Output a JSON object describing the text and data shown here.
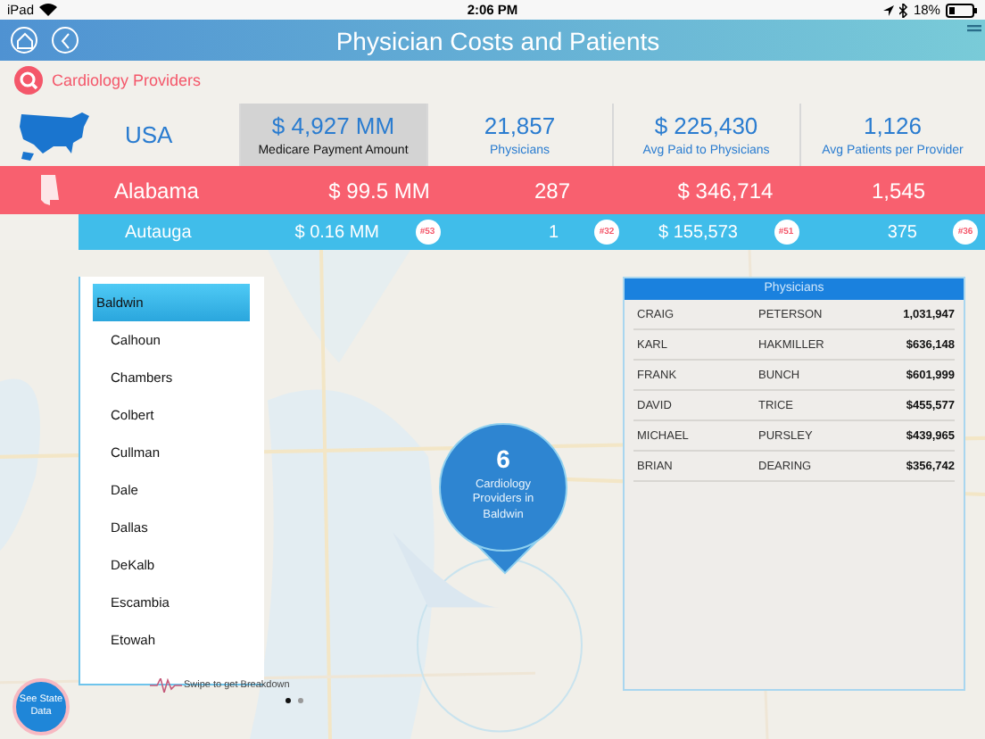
{
  "status_bar": {
    "device": "iPad",
    "time": "2:06 PM",
    "battery": "18%"
  },
  "header": {
    "title": "Physician Costs and Patients"
  },
  "category": {
    "label": "Cardiology Providers"
  },
  "summary": {
    "region": "USA",
    "metrics": [
      {
        "value": "$ 4,927 MM",
        "label": "Medicare Payment Amount",
        "selected": true
      },
      {
        "value": "21,857",
        "label": "Physicians",
        "selected": false
      },
      {
        "value": "$ 225,430",
        "label": "Avg Paid to Physicians",
        "selected": false
      },
      {
        "value": "1,126",
        "label": "Avg Patients per Provider",
        "selected": false
      }
    ]
  },
  "state_row": {
    "name": "Alabama",
    "values": [
      "$ 99.5 MM",
      "287",
      "$ 346,714",
      "1,545"
    ]
  },
  "county_row": {
    "name": "Autauga",
    "cells": [
      {
        "value": "$ 0.16 MM",
        "rank": "#53"
      },
      {
        "value": "1",
        "rank": "#32"
      },
      {
        "value": "$ 155,573",
        "rank": "#51"
      },
      {
        "value": "375",
        "rank": "#36"
      }
    ]
  },
  "county_list": {
    "items": [
      {
        "name": "Baldwin",
        "selected": true
      },
      {
        "name": "Calhoun",
        "selected": false
      },
      {
        "name": "Chambers",
        "selected": false
      },
      {
        "name": "Colbert",
        "selected": false
      },
      {
        "name": "Cullman",
        "selected": false
      },
      {
        "name": "Dale",
        "selected": false
      },
      {
        "name": "Dallas",
        "selected": false
      },
      {
        "name": "DeKalb",
        "selected": false
      },
      {
        "name": "Escambia",
        "selected": false
      },
      {
        "name": "Etowah",
        "selected": false
      }
    ],
    "hint": "Swipe to get Breakdown"
  },
  "pages": [
    {
      "selected": true
    },
    {
      "selected": false
    }
  ],
  "pin": {
    "count": "6",
    "text": "Cardiology Providers in Baldwin"
  },
  "physicians": {
    "title": "Physicians",
    "rows": [
      {
        "first": "CRAIG",
        "last": "PETERSON",
        "amount": "⁤1,031,947"
      },
      {
        "first": "KARL",
        "last": "HAKMILLER",
        "amount": "$636,148"
      },
      {
        "first": "FRANK",
        "last": "BUNCH",
        "amount": "$601,999"
      },
      {
        "first": "DAVID",
        "last": "TRICE",
        "amount": "$455,577"
      },
      {
        "first": "MICHAEL",
        "last": "PURSLEY",
        "amount": "$439,965"
      },
      {
        "first": "BRIAN",
        "last": "DEARING",
        "amount": "$356,742"
      }
    ]
  },
  "state_button": {
    "label": "See State Data"
  }
}
